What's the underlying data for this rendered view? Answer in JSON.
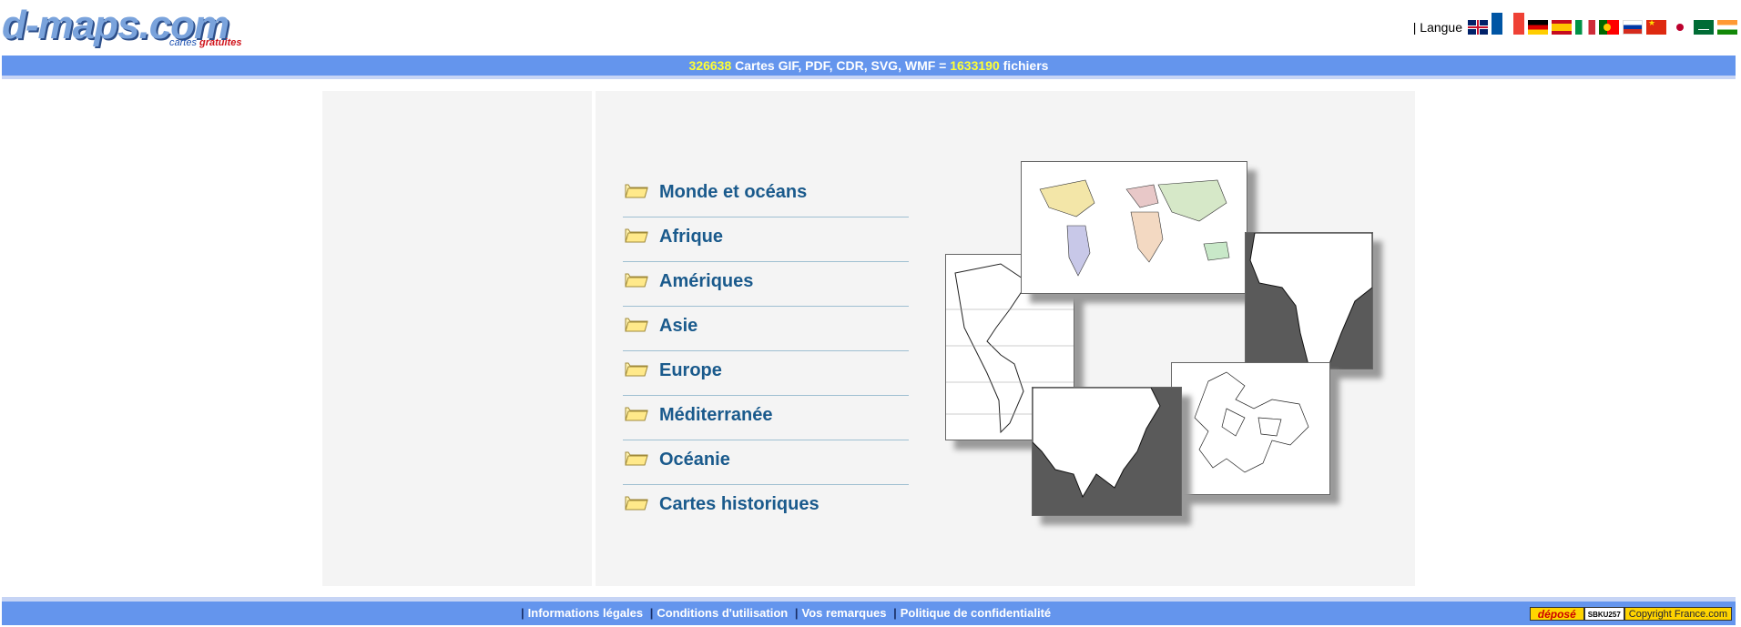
{
  "header": {
    "logo_text": "d-maps.com",
    "logo_tagline_prefix": "cartes",
    "logo_tagline_suffix": "gratuites",
    "language_label": "| Langue",
    "languages": [
      {
        "code": "en",
        "icon": "uk-flag-icon"
      },
      {
        "code": "fr",
        "icon": "france-flag-icon"
      },
      {
        "code": "de",
        "icon": "germany-flag-icon"
      },
      {
        "code": "es",
        "icon": "spain-flag-icon"
      },
      {
        "code": "it",
        "icon": "italy-flag-icon"
      },
      {
        "code": "pt",
        "icon": "portugal-flag-icon"
      },
      {
        "code": "ru",
        "icon": "russia-flag-icon"
      },
      {
        "code": "cn",
        "icon": "china-flag-icon"
      },
      {
        "code": "jp",
        "icon": "japan-flag-icon"
      },
      {
        "code": "ar",
        "icon": "saudi-flag-icon"
      },
      {
        "code": "in",
        "icon": "india-flag-icon"
      }
    ]
  },
  "stats": {
    "map_count": "326638",
    "formats_text": "Cartes GIF, PDF, CDR, SVG, WMF =",
    "file_count": "1633190",
    "files_label": "fichiers"
  },
  "menu": {
    "items": [
      {
        "label": "Monde et océans"
      },
      {
        "label": "Afrique"
      },
      {
        "label": "Amériques"
      },
      {
        "label": "Asie"
      },
      {
        "label": "Europe"
      },
      {
        "label": "Méditerranée"
      },
      {
        "label": "Océanie"
      },
      {
        "label": "Cartes historiques"
      }
    ]
  },
  "footer": {
    "sep": "|",
    "links": [
      "Informations légales",
      "Conditions d'utilisation",
      "Vos remarques",
      "Politique de confidentialité"
    ],
    "badge_left": "déposé",
    "badge_code": "SBKU257",
    "badge_right": "Copyright France.com"
  },
  "colors": {
    "bar": "#6495ed",
    "highlight_number": "#ffff33",
    "menu_text": "#1a5a8c"
  }
}
